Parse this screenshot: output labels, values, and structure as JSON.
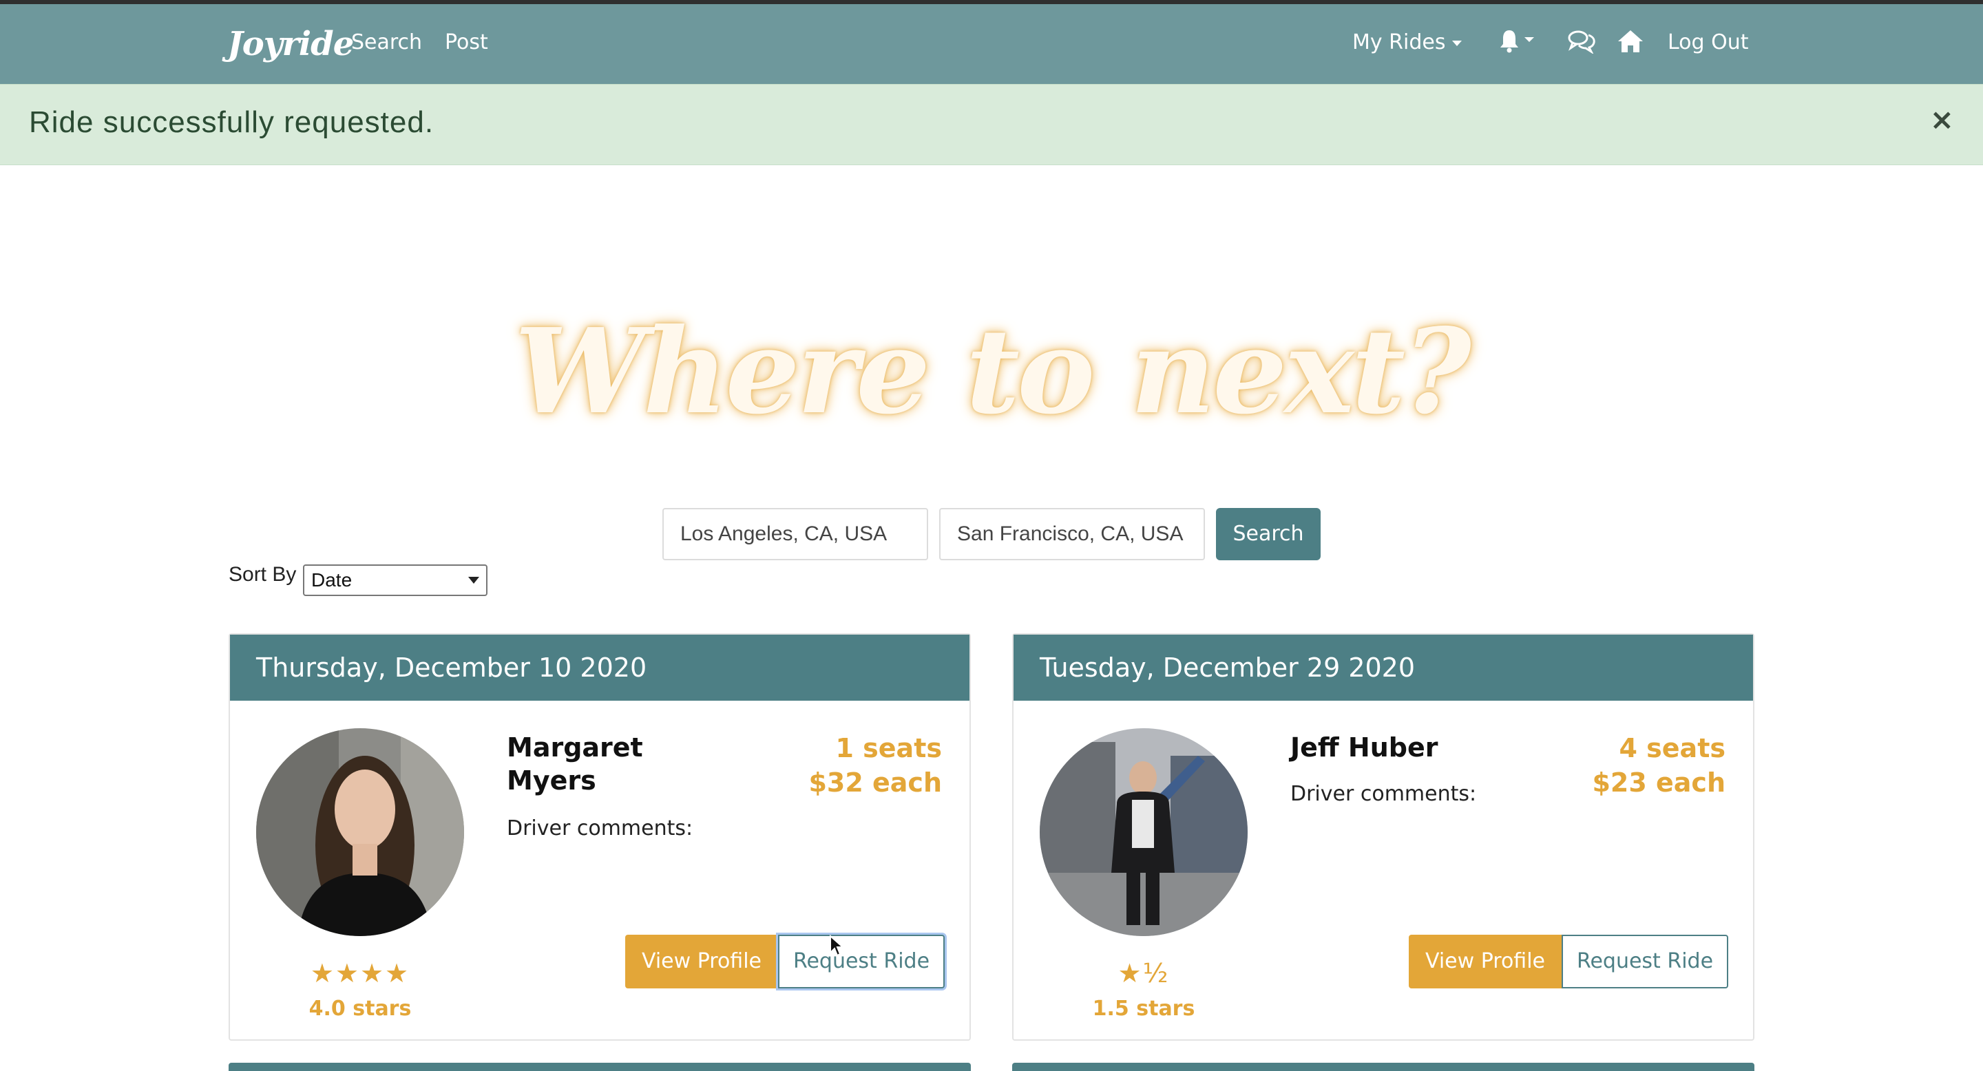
{
  "navbar": {
    "brand": "Joyride",
    "links": [
      "Search",
      "Post"
    ],
    "my_rides": "My Rides",
    "logout": "Log Out",
    "icons": [
      "bell-icon",
      "chat-icon",
      "home-icon"
    ]
  },
  "alert": {
    "message": "Ride successfully requested.",
    "close": "×"
  },
  "hero": {
    "title": "Where to next?"
  },
  "search": {
    "from": "Los Angeles, CA, USA",
    "to": "San Francisco, CA, USA",
    "button": "Search"
  },
  "sort": {
    "label": "Sort By",
    "selected": "Date"
  },
  "rides": [
    {
      "date": "Thursday, December 10 2020",
      "driver_first": "Margaret",
      "driver_last": "Myers",
      "seats": "1 seats",
      "price": "$32 each",
      "comments_label": "Driver comments:",
      "stars_display": "★★★★",
      "stars_label": "4.0 stars",
      "view_profile": "View Profile",
      "request": "Request Ride"
    },
    {
      "date": "Tuesday, December 29 2020",
      "driver_name": "Jeff Huber",
      "seats": "4 seats",
      "price": "$23 each",
      "comments_label": "Driver comments:",
      "stars_display": "★½",
      "stars_label": "1.5 stars",
      "view_profile": "View Profile",
      "request": "Request Ride"
    }
  ],
  "colors": {
    "navbar": "#6e989c",
    "primary": "#4d7f85",
    "accent": "#e3a638",
    "alert_bg": "#d9ebda"
  }
}
